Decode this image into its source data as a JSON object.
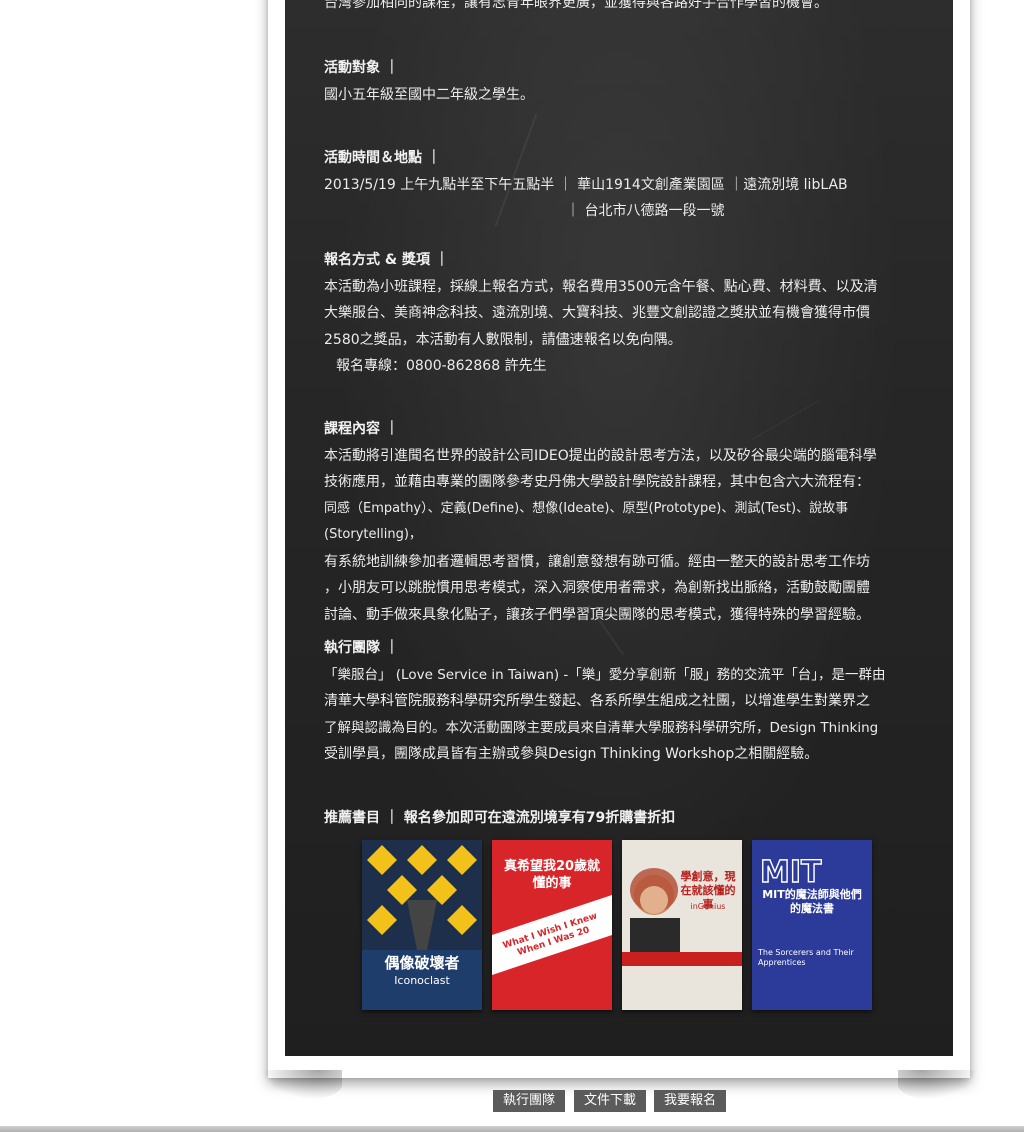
{
  "intro_tail": "台灣參加相同的課程，讓有志青年眼界更廣，並獲得與各路好手合作學習的機會。",
  "audience": {
    "heading": "活動對象 ｜",
    "text": "國小五年級至國中二年級之學生。"
  },
  "time_place": {
    "heading": "活動時間＆地點 ｜",
    "line1": "2013/5/19 上午九點半至下午五點半 ｜ 華山1914文創產業園區 ｜遠流別境 libLAB",
    "line2": "｜ 台北市八德路一段一號"
  },
  "signup": {
    "heading": "報名方式 & 獎項 ｜",
    "lines": [
      "本活動為小班課程，採線上報名方式，報名費用3500元含午餐、點心費、材料費、以及清",
      "大樂服台、美商神念科技、遠流別境、大寶科技、兆豐文創認證之獎狀並有機會獲得市價",
      "2580之獎品，本活動有人數限制，請儘速報名以免向隅。"
    ],
    "hotline": "報名專線：0800-862868 許先生"
  },
  "course": {
    "heading": "課程內容 ｜",
    "lines": [
      "本活動將引進聞名世界的設計公司IDEO提出的設計思考方法，以及矽谷最尖端的腦電科學",
      "技術應用，並藉由專業的團隊參考史丹佛大學設計學院設計課程，其中包含六大流程有：",
      "同感（Empathy）、定義(Define)、想像(Ideate)、原型(Prototype)、測試(Test)、說故事(Storytelling)，",
      "有系統地訓練參加者邏輯思考習慣，讓創意發想有跡可循。經由一整天的設計思考工作坊",
      "，小朋友可以跳脫慣用思考模式，深入洞察使用者需求，為創新找出脈絡，活動鼓勵團體",
      "討論、動手做來具象化點子，讓孩子們學習頂尖團隊的思考模式，獲得特殊的學習經驗。"
    ]
  },
  "team": {
    "heading": "執行團隊 ｜",
    "lines": [
      "「樂服台」 (Love Service in Taiwan) -「樂」愛分享創新「服」務的交流平「台」，是一群由",
      "清華大學科管院服務科學研究所學生發起、各系所學生組成之社團，以增進學生對業界之",
      "了解與認識為目的。本次活動團隊主要成員來自清華大學服務科學研究所，Design Thinking",
      "受訓學員，團隊成員皆有主辦或參與Design Thinking Workshop之相關經驗。"
    ]
  },
  "books": {
    "heading": "推薦書目 ｜ 報名參加即可在遠流別境享有79折購書折扣",
    "items": [
      {
        "title": "偶像破壞者",
        "subtitle": "Iconoclast"
      },
      {
        "title": "真希望我20歲就懂的事",
        "subtitle": "What I Wish I Knew When I Was 20"
      },
      {
        "title": "學創意，現在就該懂的事",
        "subtitle": "inGenius"
      },
      {
        "title": "MIT的魔法師與他們的魔法書",
        "subtitle": "The Sorcerers and Their Apprentices"
      }
    ]
  },
  "buttons": {
    "team": "執行團隊",
    "download": "文件下載",
    "register": "我要報名"
  },
  "colors": {
    "board": "#262626",
    "text": "#ececec",
    "button_bg": "#5b5b5b"
  }
}
